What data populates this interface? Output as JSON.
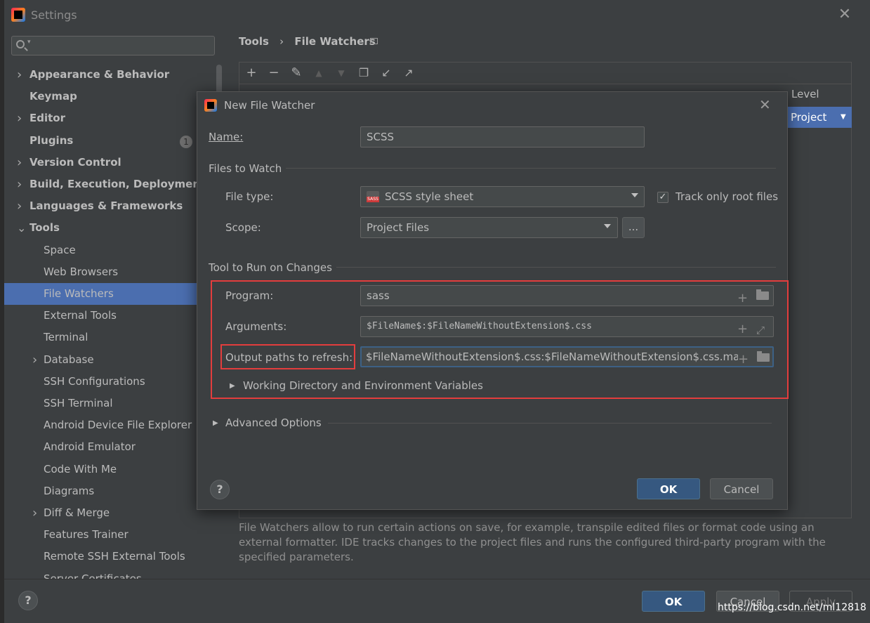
{
  "window": {
    "title": "Settings"
  },
  "search": {
    "placeholder": ""
  },
  "sidebar": {
    "items": [
      {
        "label": "Appearance & Behavior",
        "expandable": true,
        "bold": true
      },
      {
        "label": "Keymap",
        "expandable": false,
        "bold": true
      },
      {
        "label": "Editor",
        "expandable": true,
        "bold": true
      },
      {
        "label": "Plugins",
        "expandable": false,
        "bold": true,
        "badge": "1"
      },
      {
        "label": "Version Control",
        "expandable": true,
        "bold": true
      },
      {
        "label": "Build, Execution, Deployment",
        "expandable": true,
        "bold": true
      },
      {
        "label": "Languages & Frameworks",
        "expandable": true,
        "bold": true
      },
      {
        "label": "Tools",
        "expanded": true,
        "bold": true
      },
      {
        "label": "Space"
      },
      {
        "label": "Web Browsers"
      },
      {
        "label": "File Watchers",
        "selected": true
      },
      {
        "label": "External Tools"
      },
      {
        "label": "Terminal"
      },
      {
        "label": "Database",
        "expandable": true
      },
      {
        "label": "SSH Configurations"
      },
      {
        "label": "SSH Terminal"
      },
      {
        "label": "Android Device File Explorer"
      },
      {
        "label": "Android Emulator"
      },
      {
        "label": "Code With Me"
      },
      {
        "label": "Diagrams"
      },
      {
        "label": "Diff & Merge",
        "expandable": true
      },
      {
        "label": "Features Trainer"
      },
      {
        "label": "Remote SSH External Tools"
      },
      {
        "label": "Server Certificates"
      }
    ]
  },
  "breadcrumb": {
    "parent": "Tools",
    "current": "File Watchers"
  },
  "table": {
    "level_header": "Level",
    "level_value": "Project"
  },
  "description": "File Watchers allow to run certain actions on save, for example, transpile edited files or format code using an external formatter. IDE tracks changes to the project files and runs the configured third-party program with the specified parameters.",
  "footer": {
    "ok": "OK",
    "cancel": "Cancel",
    "apply": "Apply",
    "help": "?"
  },
  "watermark": "https://blog.csdn.net/ml12818",
  "dialog": {
    "title": "New File Watcher",
    "name_label": "Name:",
    "name_value": "SCSS",
    "files_section": "Files to Watch",
    "file_type_label": "File type:",
    "file_type_value": "SCSS style sheet",
    "track_root_label": "Track only root files",
    "track_root_checked": true,
    "scope_label": "Scope:",
    "scope_value": "Project Files",
    "scope_more": "...",
    "tool_section": "Tool to Run on Changes",
    "program_label": "Program:",
    "program_value": "sass",
    "arguments_label": "Arguments:",
    "arguments_value": "$FileName$:$FileNameWithoutExtension$.css",
    "output_label": "Output paths to refresh:",
    "output_value": "$FileNameWithoutExtension$.css:$FileNameWithoutExtension$.css.map",
    "working_dir_label": "Working Directory and Environment Variables",
    "advanced_label": "Advanced Options",
    "ok": "OK",
    "cancel": "Cancel",
    "help": "?"
  },
  "colors": {
    "accent": "#4b6eaf",
    "primary_button": "#365880",
    "highlight_box": "#e33d3d",
    "background": "#3c3f41"
  }
}
